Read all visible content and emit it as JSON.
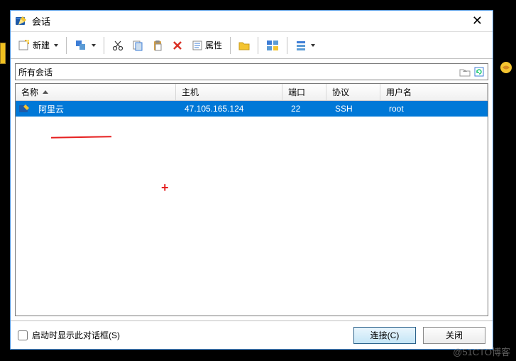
{
  "window": {
    "title": "会话"
  },
  "toolbar": {
    "new_label": "新建",
    "props_label": "属性"
  },
  "session_path": "所有会话",
  "columns": {
    "name": "名称",
    "host": "主机",
    "port": "端口",
    "protocol": "协议",
    "username": "用户名"
  },
  "rows": [
    {
      "name": "阿里云",
      "host": "47.105.165.124",
      "port": "22",
      "protocol": "SSH",
      "username": "root"
    }
  ],
  "footer": {
    "startup_checkbox": "启动时显示此对话框(S)",
    "connect": "连接(C)",
    "close": "关闭"
  },
  "watermark": "@51CTO博客"
}
